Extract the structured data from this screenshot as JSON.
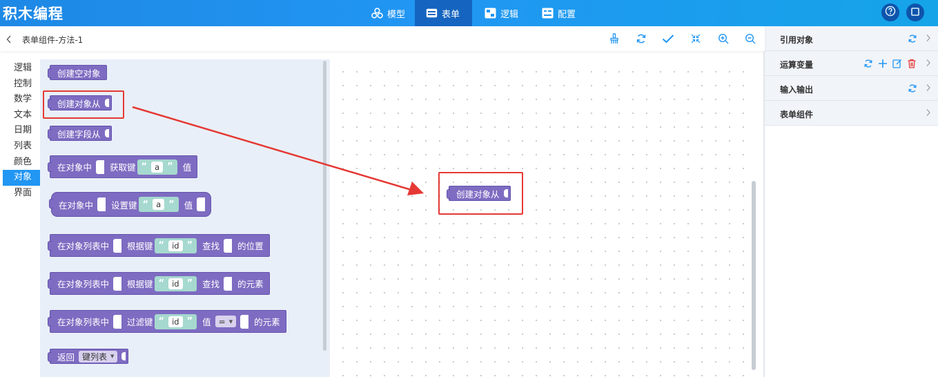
{
  "app": {
    "title": "积木编程"
  },
  "nav": [
    {
      "label": "模型",
      "icon": "model-icon"
    },
    {
      "label": "表单",
      "icon": "form-icon",
      "active": true
    },
    {
      "label": "逻辑",
      "icon": "logic-icon"
    },
    {
      "label": "配置",
      "icon": "config-icon"
    }
  ],
  "toolbar": {
    "title": "表单组件-方法-1",
    "tools": [
      "clean-icon",
      "refresh-icon",
      "check-icon",
      "fit-icon",
      "zoom-in-icon",
      "zoom-out-icon"
    ]
  },
  "categories": [
    "逻辑",
    "控制",
    "数学",
    "文本",
    "日期",
    "列表",
    "颜色",
    "对象",
    "界面"
  ],
  "active_category": "对象",
  "flyout": {
    "b1": "创建空对象",
    "b2": "创建对象从",
    "b3": "创建字段从",
    "b4": {
      "prefix": "在对象中",
      "mid": "获取键",
      "str": "a",
      "suffix": "值"
    },
    "b5": {
      "prefix": "在对象中",
      "mid": "设置键",
      "str": "a",
      "suffix": "值"
    },
    "b6": {
      "prefix": "在对象列表中",
      "mid": "根据键",
      "str": "id",
      "mid2": "查找",
      "suffix": "的位置"
    },
    "b7": {
      "prefix": "在对象列表中",
      "mid": "根据键",
      "str": "id",
      "mid2": "查找",
      "suffix": "的元素"
    },
    "b8": {
      "prefix": "在对象列表中",
      "mid": "过滤键",
      "str": "id",
      "mid2": "值",
      "op": "=",
      "suffix": "的元素"
    },
    "b9": {
      "prefix": "返回",
      "dropdown": "键列表"
    }
  },
  "workspace": {
    "block": "创建对象从"
  },
  "right_panel": [
    {
      "label": "引用对象",
      "icons": [
        "refresh-icon"
      ]
    },
    {
      "label": "运算变量",
      "icons": [
        "refresh-icon",
        "add-icon",
        "edit-icon",
        "delete-icon"
      ]
    },
    {
      "label": "输入输出",
      "icons": [
        "refresh-icon"
      ]
    },
    {
      "label": "表单组件",
      "icons": []
    }
  ],
  "colors": {
    "accent": "#2196f3",
    "block": "#7e6cc2",
    "string": "#a6d9cf",
    "highlight": "#e53935",
    "delete": "#e53935"
  }
}
